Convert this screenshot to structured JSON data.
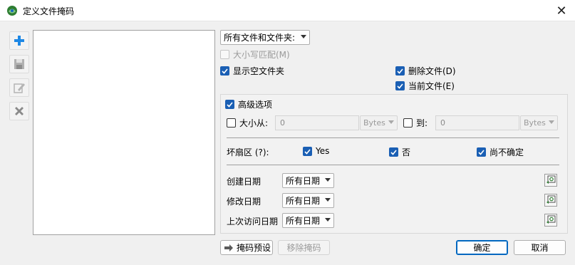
{
  "window": {
    "title": "定义文件掩码",
    "close_glyph": "✕"
  },
  "toolbar": {
    "add_icon": "plus-icon",
    "save_icon": "save-icon",
    "edit_icon": "edit-icon",
    "delete_icon": "delete-icon"
  },
  "filter": {
    "type_select": "所有文件和文件夹:",
    "case_match": "大小写匹配(M)",
    "show_empty": "显示空文件夹",
    "deleted_files": "删除文件(D)",
    "current_files": "当前文件(E)"
  },
  "advanced": {
    "header": "高级选项",
    "size_from_label": "大小从:",
    "size_from_value": "0",
    "size_from_unit": "Bytes",
    "size_to_label": "到:",
    "size_to_value": "0",
    "size_to_unit": "Bytes",
    "bad_sector_label": "坏扇区 (?):",
    "bad_yes": "Yes",
    "bad_no": "否",
    "bad_unknown": "尚不确定",
    "dates": [
      {
        "label": "创建日期",
        "value": "所有日期"
      },
      {
        "label": "修改日期",
        "value": "所有日期"
      },
      {
        "label": "上次访问日期",
        "value": "所有日期"
      }
    ]
  },
  "footer": {
    "preset_button": "掩码预设",
    "remove_button": "移除掩码",
    "ok_button": "确定",
    "cancel_button": "取消"
  },
  "colors": {
    "accent": "#1a5fb4",
    "add": "#1e88e5",
    "delete": "#8a8a8a"
  }
}
